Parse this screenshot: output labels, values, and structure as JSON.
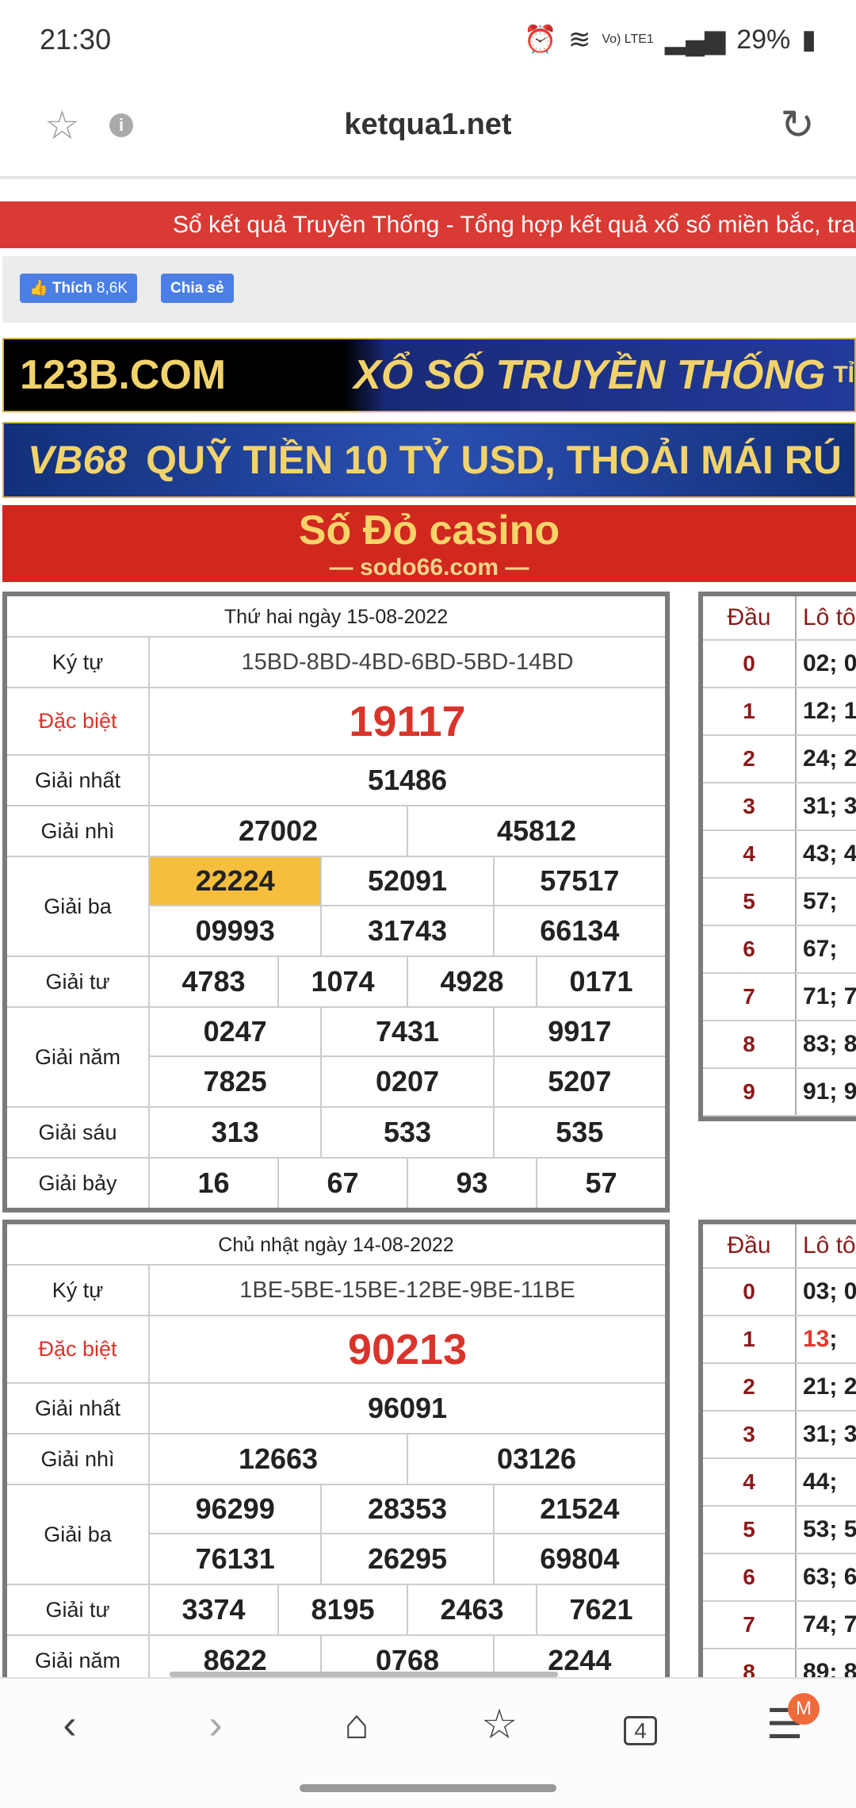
{
  "status_bar": {
    "time": "21:30",
    "network": "Vo) LTE1",
    "battery": "29%"
  },
  "browser": {
    "title": "ketqua1.net",
    "icons": [
      "star-icon",
      "info-icon",
      "reload-icon"
    ]
  },
  "marquee": "Sổ kết quả Truyền Thống - Tổng hợp kết quả xổ số miền bắc, tra",
  "fb": {
    "like_label": "Thích",
    "like_count": "8,6K",
    "share_label": "Chia sẻ"
  },
  "banners": [
    {
      "logo": "123B.COM",
      "text": "XỔ SỐ TRUYỀN THỐNG",
      "tail": "TỈ"
    },
    {
      "logo": "VB68",
      "text": "QUỸ TIỀN 10 TỶ USD, THOẢI MÁI RÚ"
    },
    {
      "logo": "Số Đỏ casino",
      "text": "— sodo66.com —"
    }
  ],
  "results": [
    {
      "date": "Thứ hai ngày 15-08-2022",
      "prizes": [
        {
          "label": "Ký tự",
          "rows": [
            [
              "15BD-8BD-4BD-6BD-5BD-14BD"
            ]
          ],
          "kind": "kt"
        },
        {
          "label": "Đặc biệt",
          "rows": [
            [
              "19117"
            ]
          ],
          "kind": "sp"
        },
        {
          "label": "Giải nhất",
          "rows": [
            [
              "51486"
            ]
          ]
        },
        {
          "label": "Giải nhì",
          "rows": [
            [
              "27002",
              "45812"
            ]
          ]
        },
        {
          "label": "Giải ba",
          "rows": [
            [
              "22224",
              "52091",
              "57517"
            ],
            [
              "09993",
              "31743",
              "66134"
            ]
          ],
          "highlight": "22224"
        },
        {
          "label": "Giải tư",
          "rows": [
            [
              "4783",
              "1074",
              "4928",
              "0171"
            ]
          ]
        },
        {
          "label": "Giải năm",
          "rows": [
            [
              "0247",
              "7431",
              "9917"
            ],
            [
              "7825",
              "0207",
              "5207"
            ]
          ]
        },
        {
          "label": "Giải sáu",
          "rows": [
            [
              "313",
              "533",
              "535"
            ]
          ]
        },
        {
          "label": "Giải bảy",
          "rows": [
            [
              "16",
              "67",
              "93",
              "57"
            ]
          ]
        }
      ],
      "loto": {
        "headers": [
          "Đầu",
          "Lô tô"
        ],
        "rows": [
          [
            "0",
            "02; 0"
          ],
          [
            "1",
            "12; 1"
          ],
          [
            "2",
            "24; 2"
          ],
          [
            "3",
            "31; 3"
          ],
          [
            "4",
            "43; 4"
          ],
          [
            "5",
            "57;"
          ],
          [
            "6",
            "67;"
          ],
          [
            "7",
            "71; 7"
          ],
          [
            "8",
            "83; 8"
          ],
          [
            "9",
            "91; 9"
          ]
        ]
      }
    },
    {
      "date": "Chủ nhật ngày 14-08-2022",
      "prizes": [
        {
          "label": "Ký tự",
          "rows": [
            [
              "1BE-5BE-15BE-12BE-9BE-11BE"
            ]
          ],
          "kind": "kt"
        },
        {
          "label": "Đặc biệt",
          "rows": [
            [
              "90213"
            ]
          ],
          "kind": "sp"
        },
        {
          "label": "Giải nhất",
          "rows": [
            [
              "96091"
            ]
          ]
        },
        {
          "label": "Giải nhì",
          "rows": [
            [
              "12663",
              "03126"
            ]
          ]
        },
        {
          "label": "Giải ba",
          "rows": [
            [
              "96299",
              "28353",
              "21524"
            ],
            [
              "76131",
              "26295",
              "69804"
            ]
          ]
        },
        {
          "label": "Giải tư",
          "rows": [
            [
              "3374",
              "8195",
              "2463",
              "7621"
            ]
          ]
        },
        {
          "label": "Giải năm",
          "rows": [
            [
              "8622",
              "0768",
              "2244"
            ]
          ]
        }
      ],
      "loto": {
        "headers": [
          "Đầu",
          "Lô tô"
        ],
        "rows": [
          [
            "0",
            "03; 0"
          ],
          [
            "1",
            "13;"
          ],
          [
            "2",
            "21; 2"
          ],
          [
            "3",
            "31; 3"
          ],
          [
            "4",
            "44;"
          ],
          [
            "5",
            "53; 5"
          ],
          [
            "6",
            "63; 6"
          ],
          [
            "7",
            "74; 7"
          ],
          [
            "8",
            "89; 8"
          ]
        ],
        "red_row": "1"
      }
    }
  ],
  "bottom_nav": {
    "tabs_count": "4",
    "profile_initial": "M"
  },
  "colors": {
    "accent_red": "#d9342b",
    "highlight": "#f5bf3d",
    "dau_color": "#8b1a1a",
    "fb_blue": "#4b7fe6"
  }
}
